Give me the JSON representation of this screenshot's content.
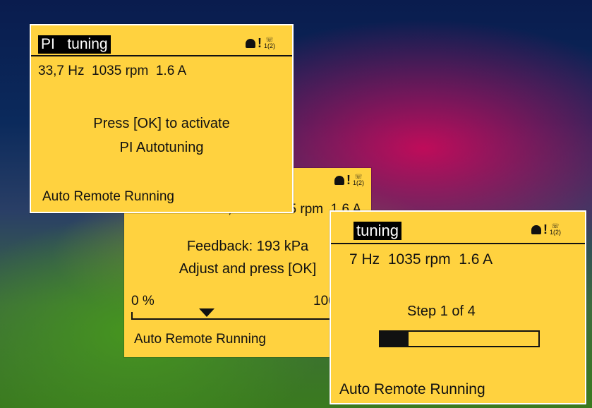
{
  "screen1": {
    "title": "PI   tuning",
    "status_line": "33,7 Hz  1035 rpm  1.6 A",
    "message_line1": "Press [OK] to activate",
    "message_line2": "PI Autotuning",
    "footer": "Auto Remote Running",
    "page_indicator": "1(2)"
  },
  "screen2": {
    "status_line": "33,7 Hz  1035 rpm  1.6 A",
    "feedback": "Feedback: 193 kPa",
    "instruction": "Adjust and press [OK]",
    "scale_min": "0 %",
    "scale_max": "100 %",
    "footer": "Auto Remote Running",
    "page_indicator": "1(2)"
  },
  "screen3": {
    "title": "tuning",
    "status_line": "7 Hz  1035 rpm  1.6 A",
    "step": "Step 1 of 4",
    "progress": 0.18,
    "footer": "Auto Remote Running",
    "page_indicator": "1(2)"
  },
  "colors": {
    "lcd": "#ffd23f",
    "ink": "#111111"
  },
  "icons": [
    "bell-icon",
    "warning-exclamation-icon",
    "handset-page-icon"
  ]
}
